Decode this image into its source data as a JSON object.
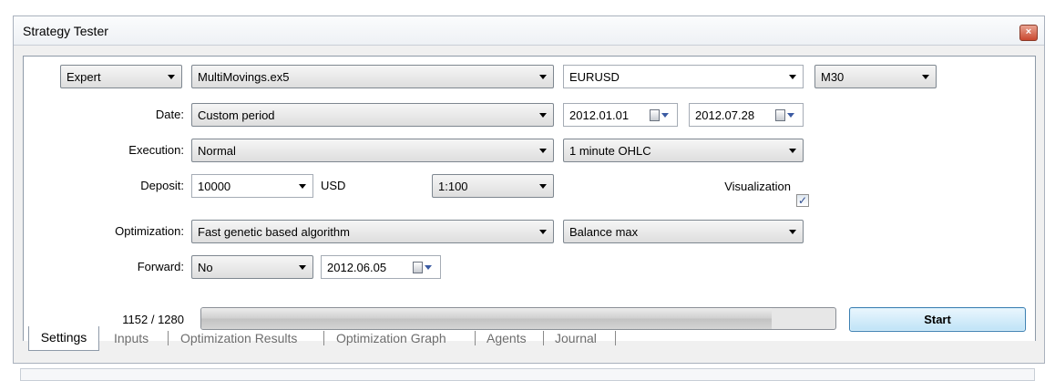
{
  "window": {
    "title": "Strategy Tester",
    "close_glyph": "x"
  },
  "row1": {
    "type_value": "Expert",
    "expert_value": "MultiMovings.ex5",
    "symbol_value": "EURUSD",
    "timeframe_value": "M30"
  },
  "date": {
    "label": "Date:",
    "period_value": "Custom period",
    "from": "2012.01.01",
    "to": "2012.07.28"
  },
  "execution": {
    "label": "Execution:",
    "mode_value": "Normal",
    "ticks_value": "1 minute OHLC"
  },
  "deposit": {
    "label": "Deposit:",
    "amount": "10000",
    "currency": "USD",
    "leverage": "1:100",
    "visualization_label": "Visualization",
    "visualization_checked": true
  },
  "optimization": {
    "label": "Optimization:",
    "algorithm_value": "Fast genetic based algorithm",
    "criterion_value": "Balance max"
  },
  "forward": {
    "label": "Forward:",
    "mode_value": "No",
    "date": "2012.06.05"
  },
  "progress": {
    "text": "1152 / 1280",
    "current": 1152,
    "total": 1280,
    "fraction": 0.9
  },
  "start_button": {
    "label": "Start"
  },
  "tabs": [
    {
      "label": "Settings",
      "selected": true
    },
    {
      "label": "Inputs"
    },
    {
      "label": "Optimization Results"
    },
    {
      "label": "Optimization Graph"
    },
    {
      "label": "Agents"
    },
    {
      "label": "Journal"
    }
  ],
  "icons": {
    "dropdown": "chevron-down-icon",
    "calendar": "calendar-icon",
    "close": "close-icon",
    "check": "checkmark-icon"
  },
  "colors": {
    "accent_start_border": "#3c7fb1",
    "accent_start_fill": "#bfe3f7",
    "close_button": "#c9482e",
    "checkbox_mark": "#2c4a8f"
  }
}
